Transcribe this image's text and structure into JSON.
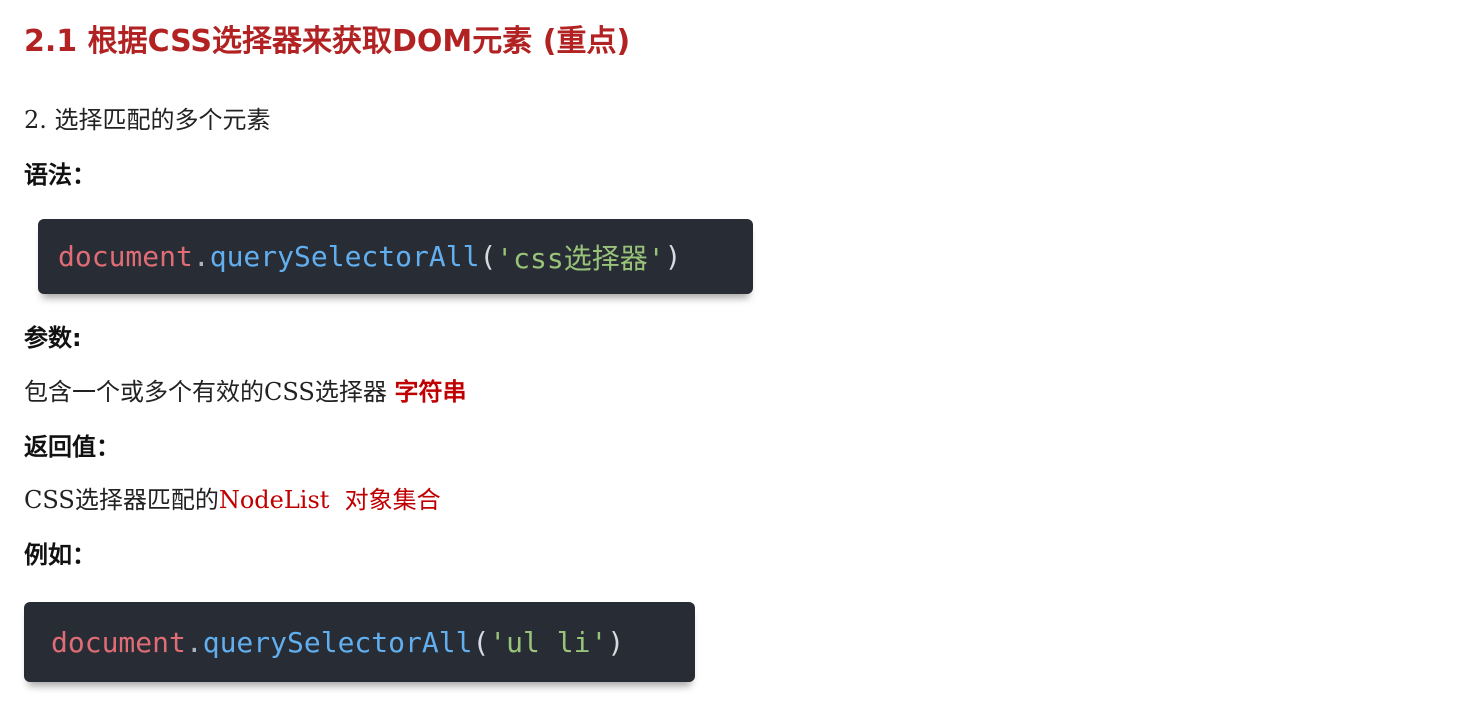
{
  "heading": "2.1 根据CSS选择器来获取DOM元素 (重点)",
  "intro": "2. 选择匹配的多个元素",
  "syntax_label": "语法：",
  "syntax_code": {
    "object": "document",
    "dot": ".",
    "method": "querySelectorAll",
    "open_paren": "(",
    "argument": "'css选择器'",
    "close_paren": ")"
  },
  "params_label": "参数:",
  "params_text": "包含一个或多个有效的CSS选择器 ",
  "params_emph": "字符串",
  "return_label": "返回值：",
  "return_text_prefix": "CSS选择器匹配的",
  "return_text_red": "NodeList  对象集合",
  "example_label": "例如：",
  "example_code": {
    "object": "document",
    "dot": ".",
    "method": "querySelectorAll",
    "open_paren": "(",
    "argument": "'ul li'",
    "close_paren": ")"
  },
  "colors": {
    "heading": "#b22222",
    "emphasis": "#c00000",
    "code_background": "#282c34",
    "code_object": "#e06c75",
    "code_method": "#61afef",
    "code_string": "#98c379"
  }
}
